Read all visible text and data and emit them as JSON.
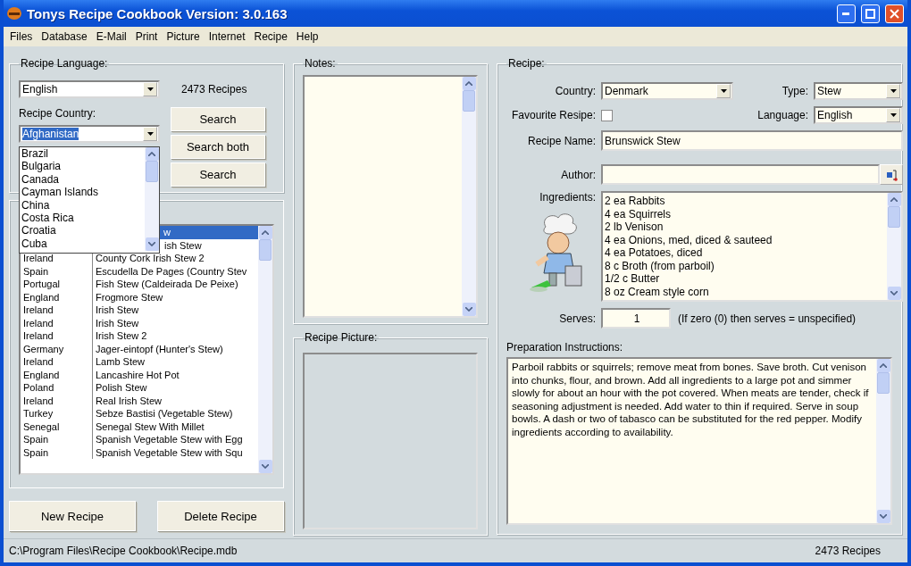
{
  "window": {
    "title": "Tonys Recipe Cookbook Version: 3.0.163"
  },
  "menu": [
    "Files",
    "Database",
    "E-Mail",
    "Print",
    "Picture",
    "Internet",
    "Recipe",
    "Help"
  ],
  "search_panel": {
    "language_label": "Recipe Language:",
    "language": "English",
    "recipe_count": "2473 Recipes",
    "country_label": "Recipe Country:",
    "country": "Afghanistan",
    "country_options": [
      "Brazil",
      "Bulgaria",
      "Canada",
      "Cayman Islands",
      "China",
      "Costa Rica",
      "Croatia",
      "Cuba"
    ],
    "buttons": [
      "Search",
      "Search both",
      "Search"
    ]
  },
  "recipes": [
    {
      "name": "w",
      "selected": true
    },
    {
      "name": "ish Stew",
      "selected": false
    },
    {
      "country": "Ireland",
      "name": "County Cork Irish Stew 2",
      "selected": false
    },
    {
      "country": "Spain",
      "name": "Escudella De Pages (Country Stev",
      "selected": false
    },
    {
      "country": "Portugal",
      "name": "Fish Stew (Caldeirada De Peixe)",
      "selected": false
    },
    {
      "country": "England",
      "name": "Frogmore Stew",
      "selected": false
    },
    {
      "country": "Ireland",
      "name": "Irish Stew",
      "selected": false
    },
    {
      "country": "Ireland",
      "name": "Irish Stew",
      "selected": false
    },
    {
      "country": "Ireland",
      "name": "Irish Stew 2",
      "selected": false
    },
    {
      "country": "Germany",
      "name": "Jager-eintopf (Hunter's Stew)",
      "selected": false
    },
    {
      "country": "Ireland",
      "name": "Lamb Stew",
      "selected": false
    },
    {
      "country": "England",
      "name": "Lancashire Hot Pot",
      "selected": false
    },
    {
      "country": "Poland",
      "name": "Polish Stew",
      "selected": false
    },
    {
      "country": "Ireland",
      "name": "Real Irish Stew",
      "selected": false
    },
    {
      "country": "Turkey",
      "name": "Sebze Bastisi (Vegetable Stew)",
      "selected": false
    },
    {
      "country": "Senegal",
      "name": "Senegal Stew With Millet",
      "selected": false
    },
    {
      "country": "Spain",
      "name": "Spanish Vegetable Stew with Egg",
      "selected": false
    },
    {
      "country": "Spain",
      "name": "Spanish Vegetable Stew with Squ",
      "selected": false
    }
  ],
  "actions": [
    "New Recipe",
    "Delete Recipe"
  ],
  "notes": {
    "label": "Notes:"
  },
  "picture": {
    "label": "Recipe Picture:"
  },
  "recipe": {
    "label": "Recipe:",
    "country": {
      "label": "Country:",
      "value": "Denmark"
    },
    "type": {
      "label": "Type:",
      "value": "Stew"
    },
    "favourite": {
      "label": "Favourite Resipe:",
      "checked": false
    },
    "language": {
      "label": "Language:",
      "value": "English"
    },
    "name": {
      "label": "Recipe Name:",
      "value": "Brunswick Stew"
    },
    "author": {
      "label": "Author:"
    },
    "ingredients": {
      "label": "Ingredients:",
      "lines": [
        "2 ea Rabbits",
        "4 ea Squirrels",
        "2 lb Venison",
        "4 ea Onions, med, diced & sauteed",
        "4 ea Potatoes, diced",
        "8 c Broth (from parboil)",
        "1/2 c Butter",
        "8 oz Cream style corn"
      ]
    },
    "serves": {
      "label": "Serves:",
      "value": "1",
      "hint": "(If zero (0) then serves = unspecified)"
    },
    "instructions": {
      "label": "Preparation Instructions:",
      "text": "Parboil rabbits or squirrels; remove meat from bones. Save broth. Cut venison into chunks, flour, and brown. Add all ingredients to a large pot and simmer slowly for about an hour with the pot covered. When meats are tender, check if seasoning adjustment is needed. Add water to thin if required. Serve in soup bowls. A dash or two of tabasco can be substituted for the red pepper. Modify ingredients according to availability."
    }
  },
  "status_bar": {
    "path": "C:\\Program Files\\Recipe Cookbook\\Recipe.mdb",
    "count": "2473 Recipes"
  }
}
